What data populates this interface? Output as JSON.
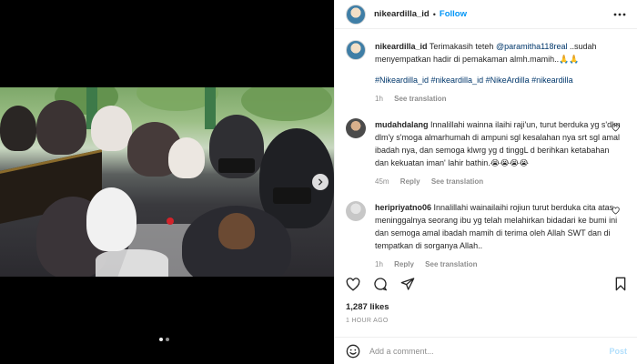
{
  "header": {
    "username": "nikeardilla_id",
    "separator": "•",
    "follow_label": "Follow",
    "more_icon": "ellipsis-icon"
  },
  "caption": {
    "username": "nikeardilla_id",
    "text_before": "Terimakasih teteh",
    "mention": "@paramitha118real",
    "text_after": "..sudah menyempatkan hadir di pemakaman almh.mamih..🙏🙏",
    "hashtags": "#Nikeardilla_id #nikeardilla_id #NikeArdilla #nikeardilla",
    "time": "1h",
    "translate_label": "See translation"
  },
  "comments": [
    {
      "username": "mudahdalang",
      "text": "Innalillahi wainna ilaihi raji'un, turut berduka yg s'dlm dlm'y s'moga almarhumah di ampuni sgl kesalahan nya srt sgl amal ibadah nya, dan semoga klwrg yg d tinggL d berihkan ketabahan dan kekuatan iman' lahir bathin.😭😭😭😭",
      "time": "45m",
      "reply_label": "Reply",
      "translate_label": "See translation"
    },
    {
      "username": "heripriyatno06",
      "text": "Innalillahi wainailaihi rojiun turut berduka cita atas meninggalnya seorang ibu yg telah melahirkan bidadari ke bumi ini dan semoga amal ibadah mamih di terima oleh Allah SWT dan di tempatkan di sorganya Allah..",
      "time": "1h",
      "reply_label": "Reply",
      "translate_label": "See translation"
    }
  ],
  "likes": "1,287 likes",
  "posted_time": "1 HOUR AGO",
  "add_comment": {
    "placeholder": "Add a comment...",
    "post_label": "Post"
  },
  "carousel": {
    "total": 2,
    "current": 1
  },
  "colors": {
    "link_blue": "#0095f6",
    "mention_blue": "#00376b",
    "muted": "#8e8e8e",
    "post_disabled": "#b2dffc"
  }
}
